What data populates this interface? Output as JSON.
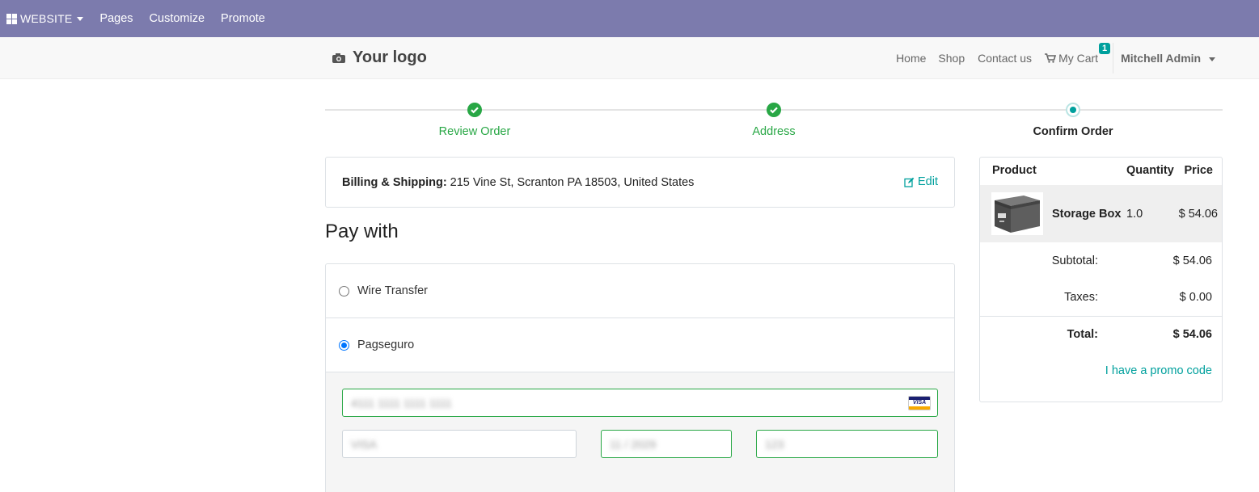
{
  "admin_bar": {
    "brand": "WEBSITE",
    "menu": [
      "Pages",
      "Customize",
      "Promote"
    ]
  },
  "header": {
    "logo": "Your logo",
    "nav": [
      "Home",
      "Shop",
      "Contact us"
    ],
    "cart_label": "My Cart",
    "cart_count": "1",
    "user": "Mitchell Admin"
  },
  "wizard": {
    "steps": [
      {
        "label": "Review Order",
        "state": "done"
      },
      {
        "label": "Address",
        "state": "done"
      },
      {
        "label": "Confirm Order",
        "state": "current"
      }
    ]
  },
  "billing": {
    "label": "Billing & Shipping:",
    "address": "215 Vine St, Scranton PA 18503, United States",
    "edit_label": "Edit"
  },
  "pay": {
    "title": "Pay with",
    "options": [
      {
        "label": "Wire Transfer",
        "checked": false
      },
      {
        "label": "Pagseguro",
        "checked": true
      }
    ],
    "card_number_placeholder": "4111 1111 1111 1111",
    "card_name_placeholder": "VISA",
    "card_expiry_placeholder": "11 / 2029",
    "card_cvc_placeholder": "123"
  },
  "summary": {
    "headers": {
      "product": "Product",
      "quantity": "Quantity",
      "price": "Price"
    },
    "item": {
      "name": "Storage Box",
      "quantity": "1.0",
      "price": "$ 54.06"
    },
    "subtotal_label": "Subtotal:",
    "subtotal": "$ 54.06",
    "taxes_label": "Taxes:",
    "taxes": "$ 0.00",
    "total_label": "Total:",
    "total": "$ 54.06",
    "promo_label": "I have a promo code"
  },
  "colors": {
    "admin_bar": "#7c7bad",
    "accent": "#00a09d",
    "success": "#28a745"
  }
}
